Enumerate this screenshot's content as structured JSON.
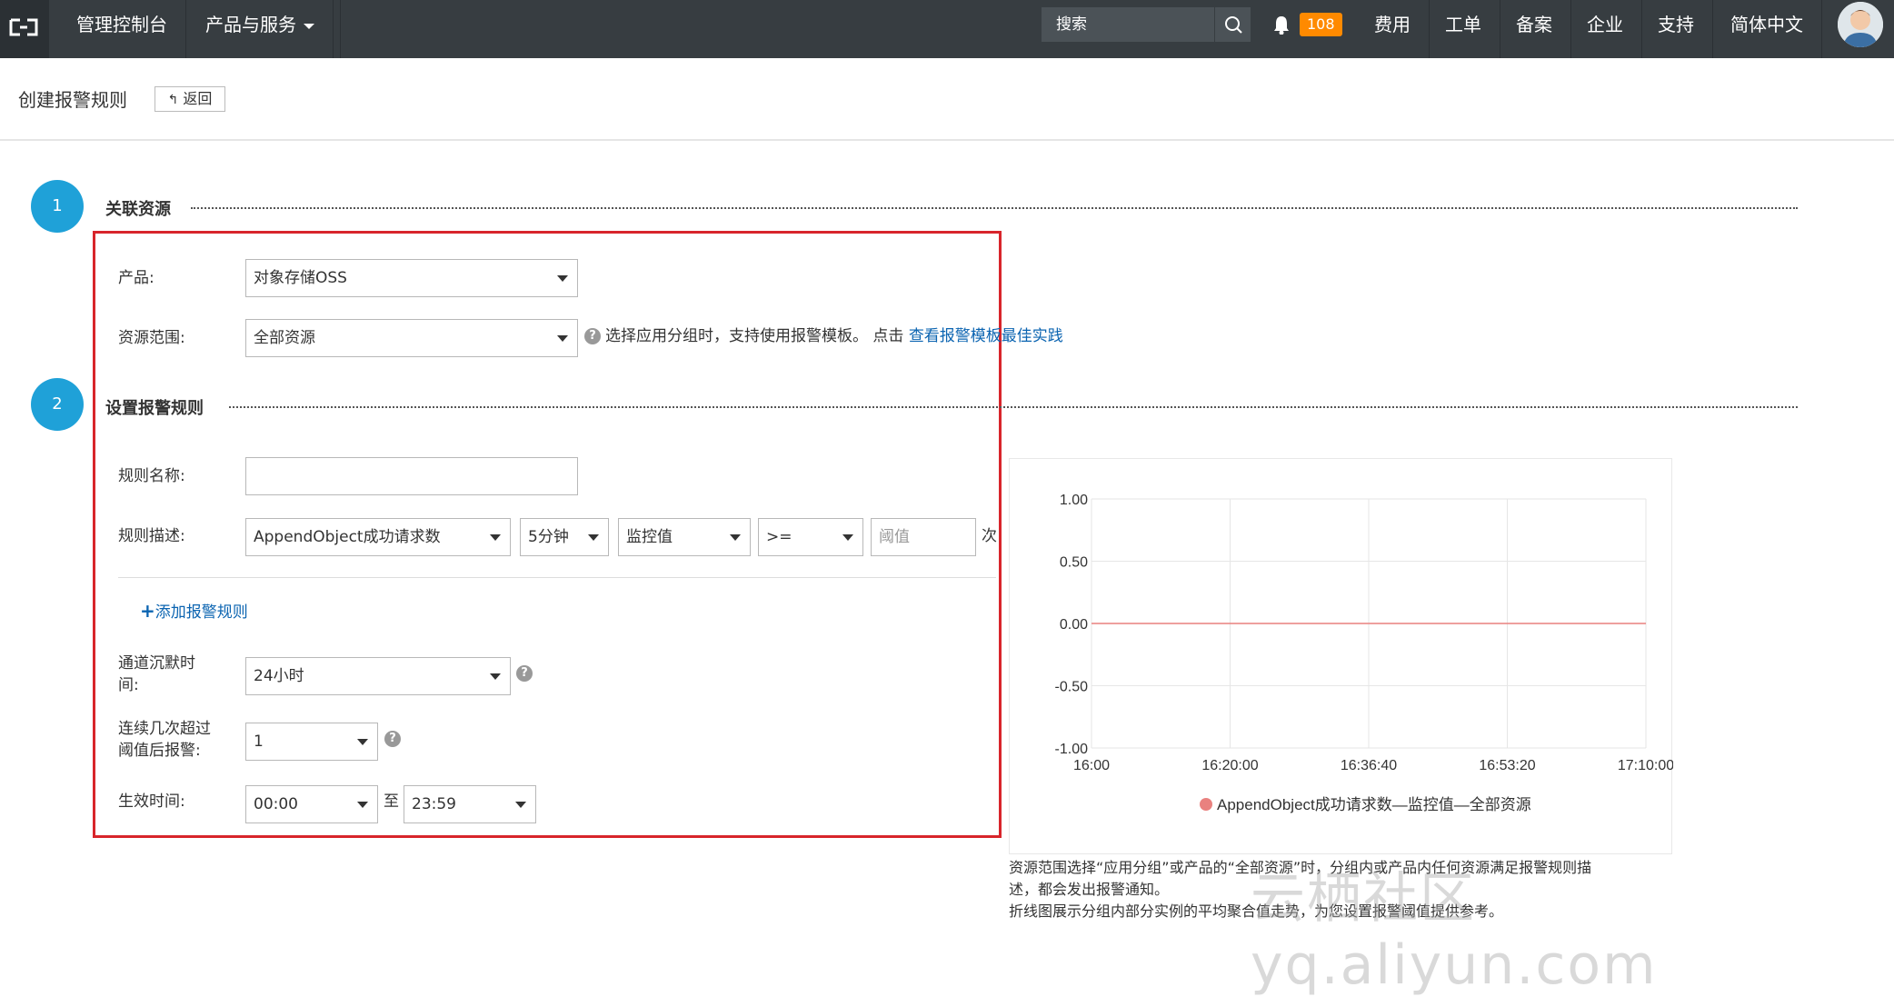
{
  "topbar": {
    "nav": [
      {
        "label": "管理控制台"
      },
      {
        "label": "产品与服务"
      }
    ],
    "search_placeholder": "搜索",
    "notification_count": "108",
    "right_links": [
      "费用",
      "工单",
      "备案",
      "企业",
      "支持",
      "简体中文"
    ]
  },
  "header": {
    "title": "创建报警规则",
    "back_label": "返回"
  },
  "step1": {
    "number": "1",
    "title": "关联资源",
    "product_label": "产品:",
    "product_value": "对象存储OSS",
    "scope_label": "资源范围:",
    "scope_value": "全部资源",
    "scope_hint": "选择应用分组时，支持使用报警模板。 点击 ",
    "scope_link": "查看报警模板最佳实践"
  },
  "step2": {
    "number": "2",
    "title": "设置报警规则",
    "rule_name_label": "规则名称:",
    "rule_name_value": "",
    "rule_desc_label": "规则描述:",
    "metric_value": "AppendObject成功请求数",
    "period_value": "5分钟",
    "stat_value": "监控值",
    "operator_value": ">=",
    "threshold_placeholder": "阈值",
    "unit": "次",
    "add_rule_label": "添加报警规则",
    "silence_label_1": "通道沉默时",
    "silence_label_2": "间:",
    "silence_value": "24小时",
    "times_label_1": "连续几次超过",
    "times_label_2": "阈值后报警:",
    "times_value": "1",
    "effective_label": "生效时间:",
    "start_time": "00:00",
    "to_label": "至",
    "end_time": "23:59"
  },
  "chart_data": {
    "type": "line",
    "x": [
      "16:00",
      "16:20:00",
      "16:36:40",
      "16:53:20",
      "17:10:00"
    ],
    "series": [
      {
        "name": "AppendObject成功请求数—监控值—全部资源",
        "values": [
          0,
          0,
          0,
          0,
          0
        ],
        "color": "#e9817f"
      }
    ],
    "yticks": [
      "1.00",
      "0.50",
      "0.00",
      "-0.50",
      "-1.00"
    ],
    "ylim": [
      -1,
      1
    ],
    "grid": true,
    "legend": "bottom"
  },
  "notes": {
    "line1": "资源范围选择“应用分组”或产品的“全部资源”时，分组内或产品内任何资源满足报警规则描",
    "line2": "述，都会发出报警通知。",
    "line3": "折线图展示分组内部分实例的平均聚合值走势，为您设置报警阈值提供参考。"
  },
  "watermark": "云栖社区 yq.aliyun.com"
}
